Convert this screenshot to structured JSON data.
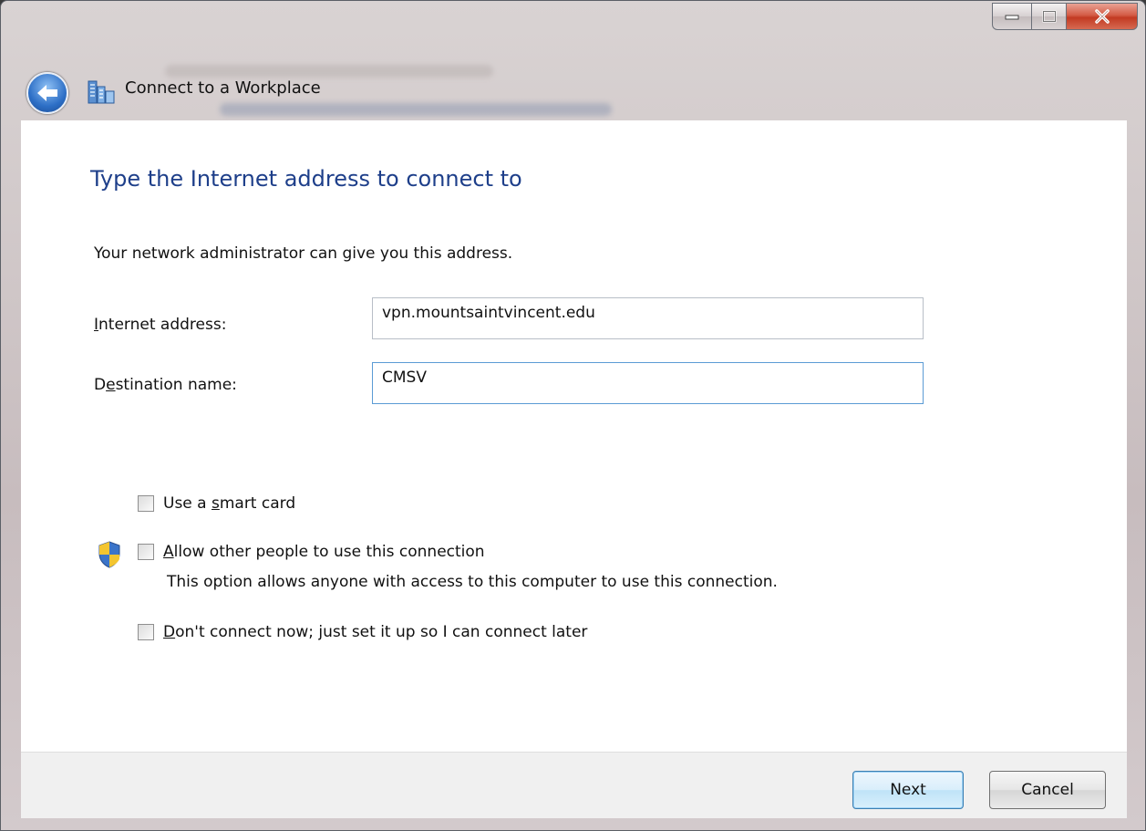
{
  "window": {
    "title": "Connect to a Workplace"
  },
  "page": {
    "heading": "Type the Internet address to connect to",
    "intro": "Your network administrator can give you this address."
  },
  "fields": {
    "internet_address": {
      "label_hotkey": "I",
      "label_rest": "nternet address:",
      "value": "vpn.mountsaintvincent.edu"
    },
    "destination_name": {
      "label_pre": "D",
      "label_hotkey": "e",
      "label_rest": "stination name:",
      "value": "CMSV"
    }
  },
  "options": {
    "smart_card": {
      "pre": "Use a ",
      "hotkey": "s",
      "rest": "mart card",
      "checked": false
    },
    "allow_others": {
      "hotkey": "A",
      "rest": "llow other people to use this connection",
      "note": "This option allows anyone with access to this computer to use this connection.",
      "checked": false
    },
    "connect_later": {
      "hotkey": "D",
      "rest": "on't connect now; just set it up so I can connect later",
      "checked": false
    }
  },
  "buttons": {
    "next": "Next",
    "cancel": "Cancel"
  },
  "icons": {
    "back": "back-arrow-icon",
    "app": "workplace-network-icon",
    "shield": "uac-shield-icon",
    "minimize": "minimize-icon",
    "maximize": "maximize-icon",
    "close": "close-icon"
  },
  "colors": {
    "heading": "#1e3f8a",
    "close_button": "#c23a22",
    "next_button_border": "#3c7fb1"
  }
}
